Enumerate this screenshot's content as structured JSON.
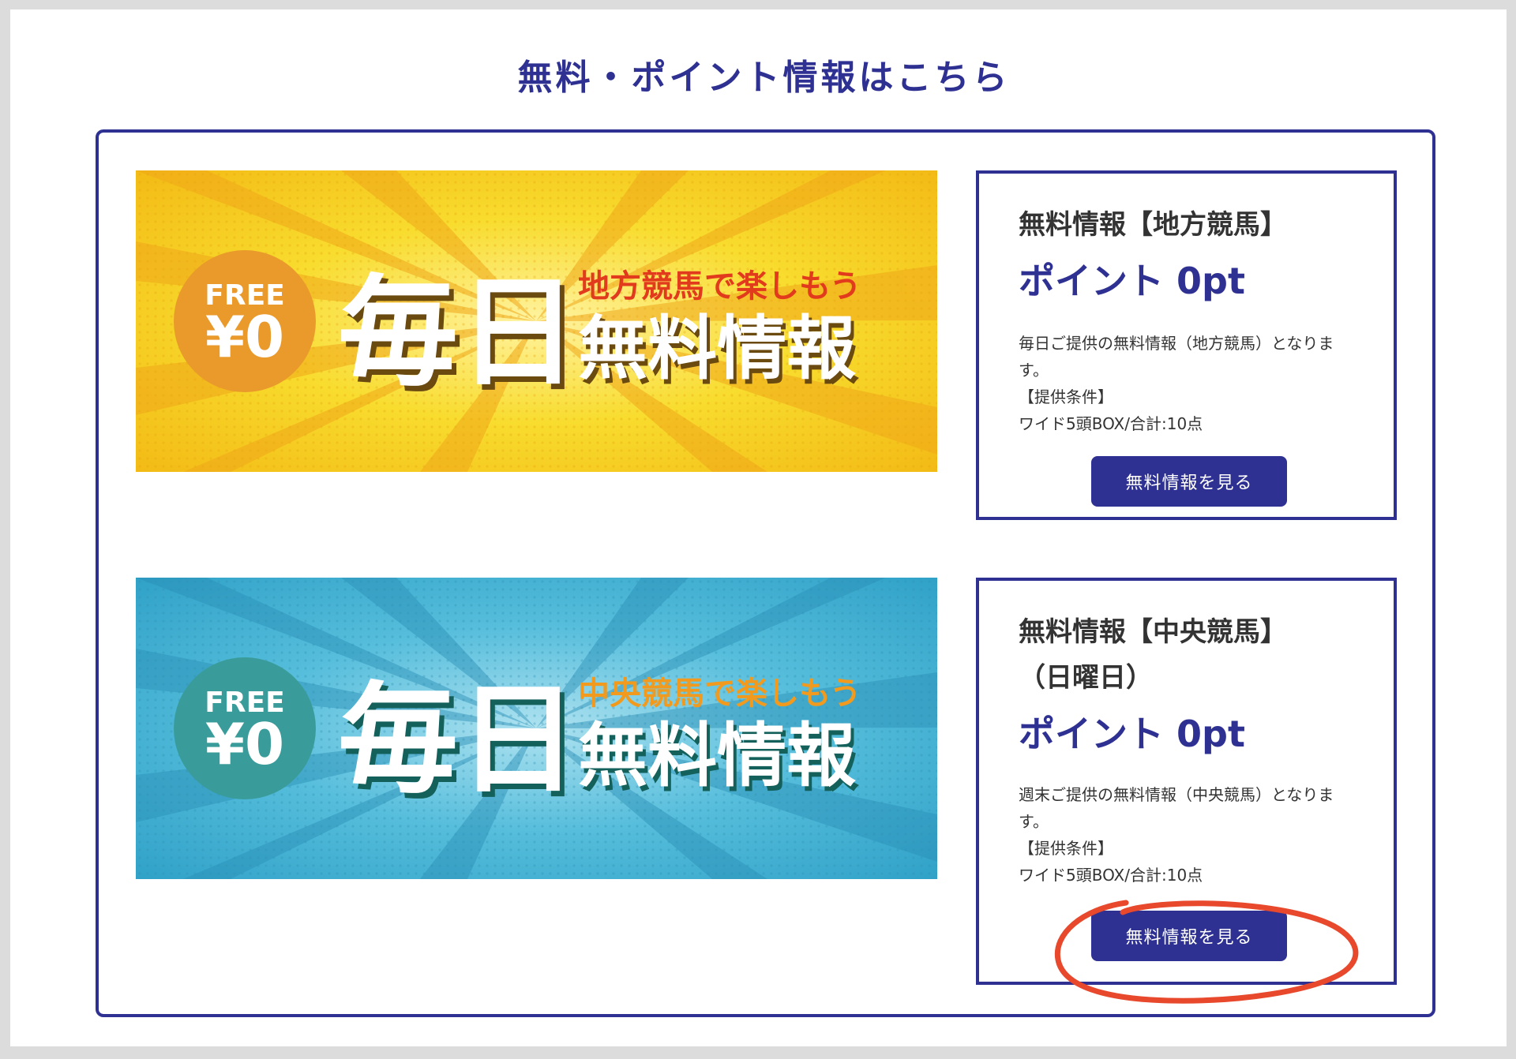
{
  "section_title": "無料・ポイント情報はこちら",
  "colors": {
    "navy": "#2e3192",
    "yellow_banner": "#f7d21a",
    "blue_banner": "#47b4d6",
    "annotation_red": "#e8482b"
  },
  "cards": [
    {
      "title": "無料情報【地方競馬】",
      "points": "ポイント 0pt",
      "desc_line1": "毎日ご提供の無料情報（地方競馬）となりま",
      "desc_line2": "す。",
      "cond_label": "【提供条件】",
      "cond_value": "ワイド5頭BOX/合計:10点",
      "button_label": "無料情報を見る",
      "banner": {
        "badge_top": "FREE",
        "badge_bottom": "¥0",
        "big": "毎日",
        "sub": "地方競馬で楽しもう",
        "main": "無料情報"
      }
    },
    {
      "title_line1": "無料情報【中央競馬】",
      "title_line2": "（日曜日）",
      "points": "ポイント 0pt",
      "desc_line1": "週末ご提供の無料情報（中央競馬）となりま",
      "desc_line2": "す。",
      "cond_label": "【提供条件】",
      "cond_value": "ワイド5頭BOX/合計:10点",
      "button_label": "無料情報を見る",
      "banner": {
        "badge_top": "FREE",
        "badge_bottom": "¥0",
        "big": "毎日",
        "sub": "中央競馬で楽しもう",
        "main": "無料情報"
      }
    }
  ]
}
